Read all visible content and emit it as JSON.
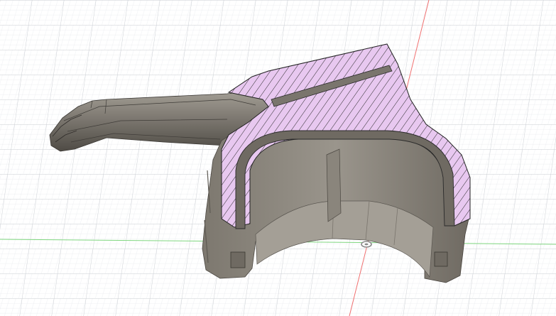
{
  "app": {
    "view": "3d-section-analysis"
  },
  "scene": {
    "background": "#ffffff",
    "grid": {
      "visible": true,
      "major_color": "#c9ccd2",
      "minor_color": "#e6e8ec"
    },
    "axes": {
      "x_color": "#7fd67f",
      "y_color": "#f07070"
    },
    "model": {
      "body_color": "#8c877f",
      "body_dark_color": "#5a5650",
      "body_light_color": "#b8b3aa",
      "section_fill_color": "#e8c8f0",
      "section_hatch_color": "#2a2a2a"
    },
    "origin_marker": {
      "visible": true,
      "icon": "origin-ring-icon"
    }
  }
}
